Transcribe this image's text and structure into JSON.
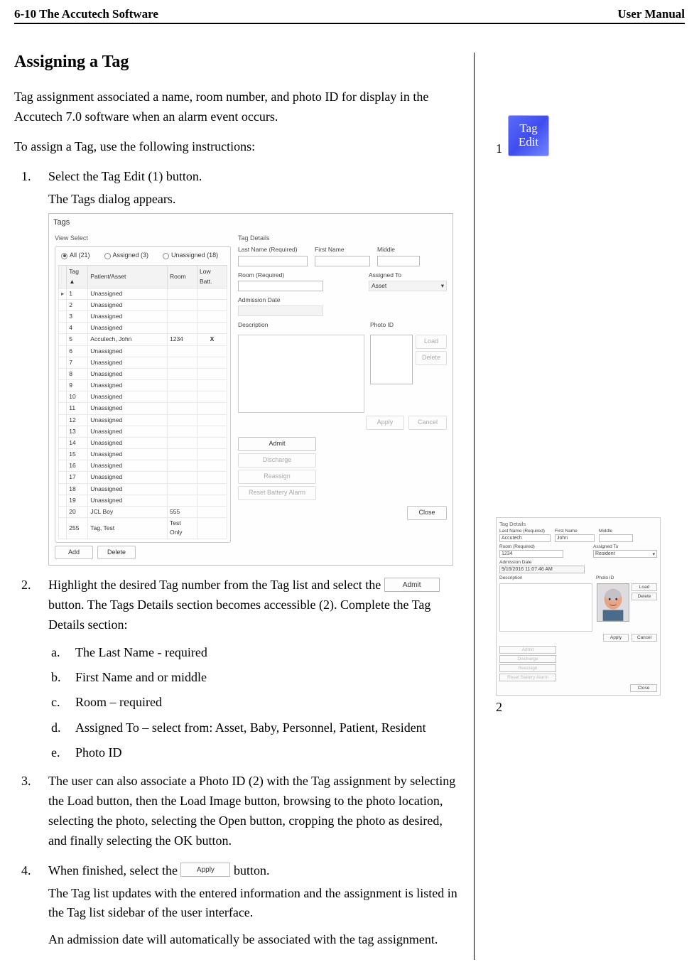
{
  "header": {
    "left": "6-10 The Accutech Software",
    "right": "User Manual"
  },
  "title": "Assigning a Tag",
  "intro1": "Tag assignment associated a name, room number, and photo ID for display in the Accutech 7.0 software when an alarm event occurs.",
  "intro2": "To assign a Tag, use the following instructions:",
  "steps": {
    "s1": {
      "num": "1.",
      "text": "Select the Tag Edit (1) button.",
      "follow": "The Tags dialog appears."
    },
    "s2": {
      "num": "2.",
      "pre": "Highlight the desired Tag number from the Tag list and select the",
      "post": "button. The Tags Details section becomes accessible (2). Complete the Tag Details section:"
    },
    "s2sub": {
      "a": {
        "l": "a.",
        "t": "The Last Name - required"
      },
      "b": {
        "l": "b.",
        "t": "First Name and or middle"
      },
      "c": {
        "l": "c.",
        "t": "Room – required"
      },
      "d": {
        "l": "d.",
        "t": "Assigned To – select from: Asset, Baby, Personnel, Patient, Resident"
      },
      "e": {
        "l": "e.",
        "t": "Photo ID"
      }
    },
    "s3": {
      "num": "3.",
      "text": "The user can also associate a Photo ID (2) with the Tag assignment by selecting the Load button, then the Load Image button, browsing to the photo location, selecting the photo, selecting the Open button, cropping the photo as desired, and finally selecting the OK button."
    },
    "s4": {
      "num": "4.",
      "pre": "When finished, select the",
      "post": "button.",
      "f1": "The Tag list updates with the entered information and the assignment is listed in the Tag list sidebar of the user interface.",
      "f2": "An admission date will automatically be associated with the tag assignment."
    }
  },
  "inline_buttons": {
    "admit": "Admit",
    "apply": "Apply"
  },
  "sidebar": {
    "idx1": "1",
    "idx2": "2",
    "tag_edit_line1": "Tag",
    "tag_edit_line2": "Edit"
  },
  "tags_dialog": {
    "title": "Tags",
    "view_select": "View Select",
    "radios": {
      "all": "All (21)",
      "assigned": "Assigned (3)",
      "unassigned": "Unassigned (18)"
    },
    "columns": {
      "tag": "Tag",
      "caret": "▲",
      "pa": "Patient/Asset",
      "room": "Room",
      "low": "Low Batt."
    },
    "rows": [
      {
        "tag": "1",
        "pa": "Unassigned",
        "room": "",
        "low": "",
        "ptr": "▸"
      },
      {
        "tag": "2",
        "pa": "Unassigned"
      },
      {
        "tag": "3",
        "pa": "Unassigned"
      },
      {
        "tag": "4",
        "pa": "Unassigned"
      },
      {
        "tag": "5",
        "pa": "Accutech, John",
        "room": "1234",
        "low": "X"
      },
      {
        "tag": "6",
        "pa": "Unassigned"
      },
      {
        "tag": "7",
        "pa": "Unassigned"
      },
      {
        "tag": "8",
        "pa": "Unassigned"
      },
      {
        "tag": "9",
        "pa": "Unassigned"
      },
      {
        "tag": "10",
        "pa": "Unassigned"
      },
      {
        "tag": "11",
        "pa": "Unassigned"
      },
      {
        "tag": "12",
        "pa": "Unassigned"
      },
      {
        "tag": "13",
        "pa": "Unassigned"
      },
      {
        "tag": "14",
        "pa": "Unassigned"
      },
      {
        "tag": "15",
        "pa": "Unassigned"
      },
      {
        "tag": "16",
        "pa": "Unassigned"
      },
      {
        "tag": "17",
        "pa": "Unassigned"
      },
      {
        "tag": "18",
        "pa": "Unassigned"
      },
      {
        "tag": "19",
        "pa": "Unassigned"
      },
      {
        "tag": "20",
        "pa": "JCL Boy",
        "room": "555"
      },
      {
        "tag": "255",
        "pa": "Tag, Test",
        "room": "Test Only"
      }
    ],
    "buttons": {
      "add": "Add",
      "delete": "Delete"
    },
    "details": {
      "header": "Tag Details",
      "labels": {
        "last": "Last Name (Required)",
        "first": "First Name",
        "middle": "Middle",
        "room": "Room (Required)",
        "assigned": "Assigned To",
        "admission": "Admission Date",
        "description": "Description",
        "photo": "Photo ID"
      },
      "assigned_value": "Asset",
      "photo_buttons": {
        "load": "Load",
        "delete": "Delete"
      },
      "apply": "Apply",
      "cancel": "Cancel",
      "actions": {
        "admit": "Admit",
        "discharge": "Discharge",
        "reassign": "Reassign",
        "reset": "Reset Battery Alarm"
      },
      "close": "Close"
    }
  },
  "side_panel": {
    "header": "Tag Details",
    "labels": {
      "last": "Last Name (Required)",
      "first": "First Name",
      "middle": "Middle",
      "room": "Room (Required)",
      "assigned": "Assigned To",
      "admission": "Admission Date",
      "description": "Description",
      "photo": "Photo ID"
    },
    "values": {
      "last": "Accutech",
      "first": "John",
      "room": "1234",
      "assigned": "Resident",
      "admission": "9/16/2016 11:07:46 AM"
    },
    "photo_buttons": {
      "load": "Load",
      "delete": "Delete"
    },
    "apply": "Apply",
    "cancel": "Cancel",
    "actions": {
      "admit": "Admit",
      "discharge": "Discharge",
      "reassign": "Reassign",
      "reset": "Reset Battery Alarm"
    },
    "close": "Close"
  }
}
